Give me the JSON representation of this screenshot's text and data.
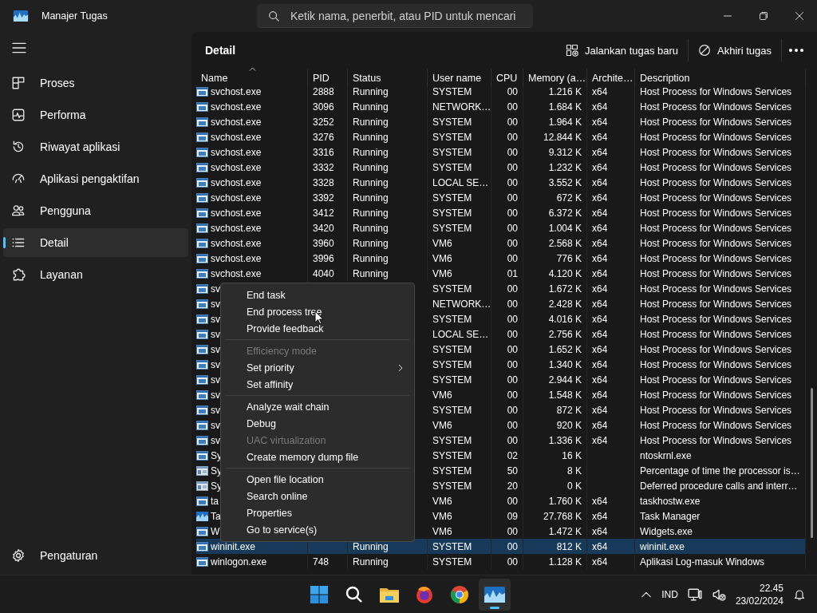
{
  "window": {
    "title": "Manajer Tugas",
    "search": {
      "placeholder": "Ketik nama, penerbit, atau PID untuk mencari"
    }
  },
  "sidebar": {
    "items": [
      {
        "label": "Proses",
        "kind": "processes",
        "selected": false
      },
      {
        "label": "Performa",
        "kind": "performance",
        "selected": false
      },
      {
        "label": "Riwayat aplikasi",
        "kind": "history",
        "selected": false
      },
      {
        "label": "Aplikasi pengaktifan",
        "kind": "startup",
        "selected": false
      },
      {
        "label": "Pengguna",
        "kind": "users",
        "selected": false
      },
      {
        "label": "Detail",
        "kind": "details",
        "selected": true
      },
      {
        "label": "Layanan",
        "kind": "services",
        "selected": false
      }
    ],
    "footer": {
      "label": "Pengaturan"
    }
  },
  "toolbar": {
    "title": "Detail",
    "buttons": [
      {
        "label": "Jalankan tugas baru",
        "kind": "new"
      },
      {
        "label": "Akhiri tugas",
        "kind": "end"
      }
    ]
  },
  "table": {
    "columns": [
      {
        "label": "Name",
        "sorted": true
      },
      {
        "label": "PID",
        "sorted": false
      },
      {
        "label": "Status",
        "sorted": false
      },
      {
        "label": "User name",
        "sorted": false
      },
      {
        "label": "CPU",
        "sorted": false
      },
      {
        "label": "Memory (a…",
        "sorted": false
      },
      {
        "label": "Archite…",
        "sorted": false
      },
      {
        "label": "Description",
        "sorted": false
      }
    ],
    "rows": [
      {
        "kind": "app",
        "name": "svchost.exe",
        "pid": "2888",
        "status": "Running",
        "user": "SYSTEM",
        "cpu": "00",
        "memory": "1.216 K",
        "arch": "x64",
        "description": "Host Process for Windows Services",
        "selected": false
      },
      {
        "kind": "app",
        "name": "svchost.exe",
        "pid": "3096",
        "status": "Running",
        "user": "NETWORK…",
        "cpu": "00",
        "memory": "1.684 K",
        "arch": "x64",
        "description": "Host Process for Windows Services",
        "selected": false
      },
      {
        "kind": "app",
        "name": "svchost.exe",
        "pid": "3252",
        "status": "Running",
        "user": "SYSTEM",
        "cpu": "00",
        "memory": "1.964 K",
        "arch": "x64",
        "description": "Host Process for Windows Services",
        "selected": false
      },
      {
        "kind": "app",
        "name": "svchost.exe",
        "pid": "3276",
        "status": "Running",
        "user": "SYSTEM",
        "cpu": "00",
        "memory": "12.844 K",
        "arch": "x64",
        "description": "Host Process for Windows Services",
        "selected": false
      },
      {
        "kind": "app",
        "name": "svchost.exe",
        "pid": "3316",
        "status": "Running",
        "user": "SYSTEM",
        "cpu": "00",
        "memory": "9.312 K",
        "arch": "x64",
        "description": "Host Process for Windows Services",
        "selected": false
      },
      {
        "kind": "app",
        "name": "svchost.exe",
        "pid": "3332",
        "status": "Running",
        "user": "SYSTEM",
        "cpu": "00",
        "memory": "1.232 K",
        "arch": "x64",
        "description": "Host Process for Windows Services",
        "selected": false
      },
      {
        "kind": "app",
        "name": "svchost.exe",
        "pid": "3328",
        "status": "Running",
        "user": "LOCAL SE…",
        "cpu": "00",
        "memory": "3.552 K",
        "arch": "x64",
        "description": "Host Process for Windows Services",
        "selected": false
      },
      {
        "kind": "app",
        "name": "svchost.exe",
        "pid": "3392",
        "status": "Running",
        "user": "SYSTEM",
        "cpu": "00",
        "memory": "672 K",
        "arch": "x64",
        "description": "Host Process for Windows Services",
        "selected": false
      },
      {
        "kind": "app",
        "name": "svchost.exe",
        "pid": "3412",
        "status": "Running",
        "user": "SYSTEM",
        "cpu": "00",
        "memory": "6.372 K",
        "arch": "x64",
        "description": "Host Process for Windows Services",
        "selected": false
      },
      {
        "kind": "app",
        "name": "svchost.exe",
        "pid": "3420",
        "status": "Running",
        "user": "SYSTEM",
        "cpu": "00",
        "memory": "1.004 K",
        "arch": "x64",
        "description": "Host Process for Windows Services",
        "selected": false
      },
      {
        "kind": "app",
        "name": "svchost.exe",
        "pid": "3960",
        "status": "Running",
        "user": "VM6",
        "cpu": "00",
        "memory": "2.568 K",
        "arch": "x64",
        "description": "Host Process for Windows Services",
        "selected": false
      },
      {
        "kind": "app",
        "name": "svchost.exe",
        "pid": "3996",
        "status": "Running",
        "user": "VM6",
        "cpu": "00",
        "memory": "776 K",
        "arch": "x64",
        "description": "Host Process for Windows Services",
        "selected": false
      },
      {
        "kind": "app",
        "name": "svchost.exe",
        "pid": "4040",
        "status": "Running",
        "user": "VM6",
        "cpu": "01",
        "memory": "4.120 K",
        "arch": "x64",
        "description": "Host Process for Windows Services",
        "selected": false
      },
      {
        "kind": "app",
        "name": "sv",
        "user": "SYSTEM",
        "cpu": "00",
        "memory": "1.672 K",
        "arch": "x64",
        "description": "Host Process for Windows Services",
        "selected": false
      },
      {
        "kind": "app",
        "name": "sv",
        "user": "NETWORK…",
        "cpu": "00",
        "memory": "2.428 K",
        "arch": "x64",
        "description": "Host Process for Windows Services",
        "selected": false
      },
      {
        "kind": "app",
        "name": "sv",
        "user": "SYSTEM",
        "cpu": "00",
        "memory": "4.016 K",
        "arch": "x64",
        "description": "Host Process for Windows Services",
        "selected": false
      },
      {
        "kind": "app",
        "name": "sv",
        "user": "LOCAL SE…",
        "cpu": "00",
        "memory": "2.756 K",
        "arch": "x64",
        "description": "Host Process for Windows Services",
        "selected": false
      },
      {
        "kind": "app",
        "name": "sv",
        "user": "SYSTEM",
        "cpu": "00",
        "memory": "1.652 K",
        "arch": "x64",
        "description": "Host Process for Windows Services",
        "selected": false
      },
      {
        "kind": "app",
        "name": "sv",
        "user": "SYSTEM",
        "cpu": "00",
        "memory": "1.340 K",
        "arch": "x64",
        "description": "Host Process for Windows Services",
        "selected": false
      },
      {
        "kind": "app",
        "name": "sv",
        "user": "SYSTEM",
        "cpu": "00",
        "memory": "2.944 K",
        "arch": "x64",
        "description": "Host Process for Windows Services",
        "selected": false
      },
      {
        "kind": "app",
        "name": "sv",
        "user": "VM6",
        "cpu": "00",
        "memory": "1.548 K",
        "arch": "x64",
        "description": "Host Process for Windows Services",
        "selected": false
      },
      {
        "kind": "app",
        "name": "sv",
        "user": "SYSTEM",
        "cpu": "00",
        "memory": "872 K",
        "arch": "x64",
        "description": "Host Process for Windows Services",
        "selected": false
      },
      {
        "kind": "app",
        "name": "sv",
        "user": "VM6",
        "cpu": "00",
        "memory": "920 K",
        "arch": "x64",
        "description": "Host Process for Windows Services",
        "selected": false
      },
      {
        "kind": "app",
        "name": "sv",
        "user": "SYSTEM",
        "cpu": "00",
        "memory": "1.336 K",
        "arch": "x64",
        "description": "Host Process for Windows Services",
        "selected": false
      },
      {
        "kind": "app",
        "name": "Sy",
        "user": "SYSTEM",
        "cpu": "02",
        "memory": "16 K",
        "description": "ntoskrnl.exe",
        "selected": false
      },
      {
        "kind": "system",
        "name": "Sy",
        "user": "SYSTEM",
        "cpu": "50",
        "memory": "8 K",
        "description": "Percentage of time the processor is…",
        "selected": false
      },
      {
        "kind": "system",
        "name": "Sy",
        "user": "SYSTEM",
        "cpu": "20",
        "memory": "0 K",
        "description": "Deferred procedure calls and interr…",
        "selected": false
      },
      {
        "kind": "app",
        "name": "ta",
        "user": "VM6",
        "cpu": "00",
        "memory": "1.760 K",
        "arch": "x64",
        "description": "taskhostw.exe",
        "selected": false
      },
      {
        "kind": "monitor",
        "name": "Ta",
        "user": "VM6",
        "cpu": "09",
        "memory": "27.768 K",
        "arch": "x64",
        "description": "Task Manager",
        "selected": false
      },
      {
        "kind": "app",
        "name": "W",
        "user": "VM6",
        "cpu": "00",
        "memory": "1.472 K",
        "arch": "x64",
        "description": "Widgets.exe",
        "selected": false
      },
      {
        "kind": "app",
        "name": "wininit.exe",
        "status": "Running",
        "user": "SYSTEM",
        "cpu": "00",
        "memory": "812 K",
        "arch": "x64",
        "description": "wininit.exe",
        "selected": true
      },
      {
        "kind": "app",
        "name": "winlogon.exe",
        "pid": "748",
        "status": "Running",
        "user": "SYSTEM",
        "cpu": "00",
        "memory": "1.128 K",
        "arch": "x64",
        "description": "Aplikasi Log-masuk Windows",
        "selected": false
      }
    ]
  },
  "context_menu": {
    "items": [
      {
        "kind": "item",
        "label": "End task",
        "disabled": false,
        "submenu": false
      },
      {
        "kind": "item",
        "label": "End process tree",
        "disabled": false,
        "submenu": false
      },
      {
        "kind": "item",
        "label": "Provide feedback",
        "disabled": false,
        "submenu": false
      },
      {
        "kind": "separator"
      },
      {
        "kind": "item",
        "label": "Efficiency mode",
        "disabled": true,
        "submenu": false
      },
      {
        "kind": "item",
        "label": "Set priority",
        "disabled": false,
        "submenu": true
      },
      {
        "kind": "item",
        "label": "Set affinity",
        "disabled": false,
        "submenu": false
      },
      {
        "kind": "separator"
      },
      {
        "kind": "item",
        "label": "Analyze wait chain",
        "disabled": false,
        "submenu": false
      },
      {
        "kind": "item",
        "label": "Debug",
        "disabled": false,
        "submenu": false
      },
      {
        "kind": "item",
        "label": "UAC virtualization",
        "disabled": true,
        "submenu": false
      },
      {
        "kind": "item",
        "label": "Create memory dump file",
        "disabled": false,
        "submenu": false
      },
      {
        "kind": "separator"
      },
      {
        "kind": "item",
        "label": "Open file location",
        "disabled": false,
        "submenu": false
      },
      {
        "kind": "item",
        "label": "Search online",
        "disabled": false,
        "submenu": false
      },
      {
        "kind": "item",
        "label": "Properties",
        "disabled": false,
        "submenu": false
      },
      {
        "kind": "item",
        "label": "Go to service(s)",
        "disabled": false,
        "submenu": false
      }
    ]
  },
  "taskbar": {
    "apps": [
      {
        "kind": "start",
        "active": false
      },
      {
        "kind": "search",
        "active": false
      },
      {
        "kind": "folder",
        "active": false
      },
      {
        "kind": "fox",
        "active": false
      },
      {
        "kind": "round",
        "active": false
      },
      {
        "kind": "monitor",
        "active": true
      }
    ],
    "tray": {
      "language": "IND",
      "time": "22.45",
      "date": "23/02/2024"
    }
  }
}
